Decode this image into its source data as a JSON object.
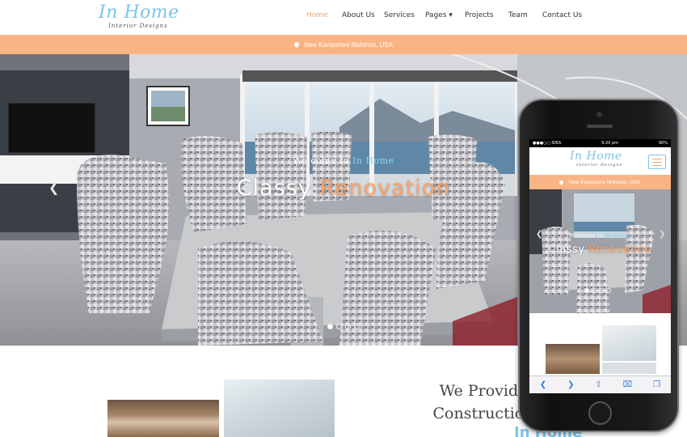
{
  "brand": {
    "name": "In Home",
    "tagline": "Interior Designs",
    "accent_blue": "#7fc4ea",
    "accent_orange": "#f7a46b",
    "bar_color": "#f9b485"
  },
  "nav": {
    "items": [
      {
        "label": "Home",
        "active": true
      },
      {
        "label": "About Us"
      },
      {
        "label": "Services"
      },
      {
        "label": "Pages ▾"
      },
      {
        "label": "Projects"
      },
      {
        "label": "Team"
      },
      {
        "label": "Contact Us"
      }
    ]
  },
  "topbar": {
    "location": "New Kampshire Mshinon, USA",
    "icon": "map-pin-icon"
  },
  "hero": {
    "welcome_text": "Welcome to",
    "welcome_accent": "In Home",
    "headline_white": "Classy",
    "headline_accent": "Renovation",
    "prev_icon": "chevron-left-icon",
    "next_icon": "chevron-right-icon",
    "slide_count": 4,
    "active_slide": 1
  },
  "about": {
    "heading_line1": "We Provide",
    "heading_line2": "Construction",
    "brand_accent": "In Home"
  },
  "phone": {
    "status_carrier": "●●●○○ IDEA",
    "status_time": "9:20 pm",
    "status_battery": "90%",
    "toolbar_icons": [
      "back-icon",
      "forward-icon",
      "share-icon",
      "bookmarks-icon",
      "tabs-icon"
    ],
    "toolbar_glyphs": [
      "❮",
      "❯",
      "⇪",
      "⌧",
      "❐"
    ]
  }
}
